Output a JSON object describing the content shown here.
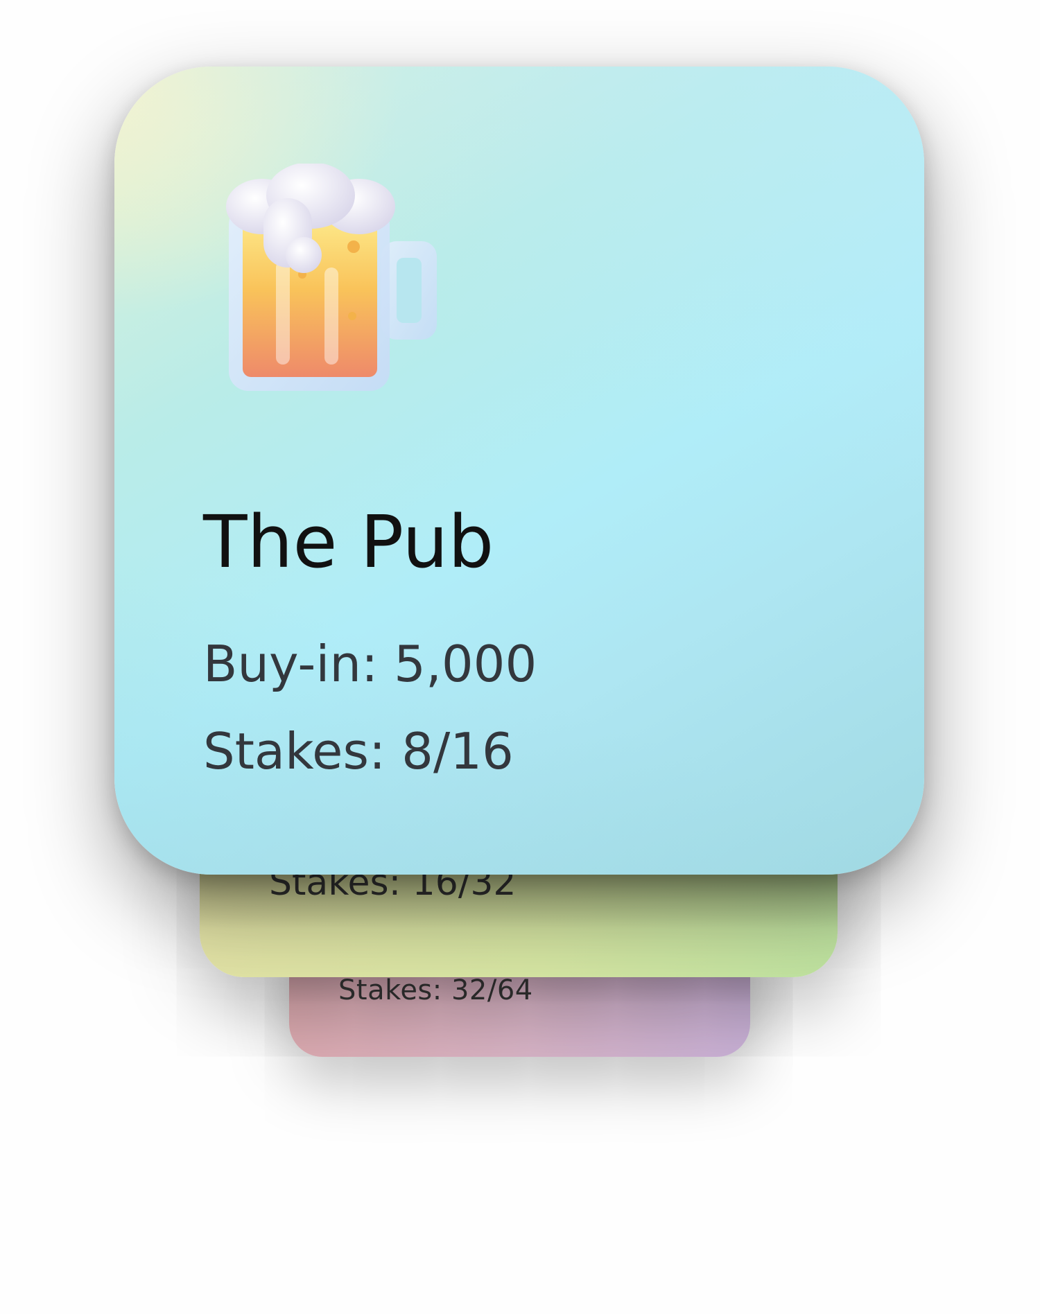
{
  "cards": [
    {
      "title": "The Pub",
      "icon": "beer-mug-icon",
      "buy_in": "Buy-in: 5,000",
      "stakes": "Stakes: 8/16",
      "colors": {
        "from": "#fbf5c9",
        "mid": "#b0edf8",
        "to": "#a1d9e3"
      }
    },
    {
      "stakes": "Stakes: 16/32",
      "colors": {
        "from": "#e4e3a6",
        "to": "#bfe3a0"
      }
    },
    {
      "stakes": "Stakes: 32/64",
      "colors": {
        "from": "#dca9ae",
        "to": "#c9b1d7"
      }
    }
  ]
}
